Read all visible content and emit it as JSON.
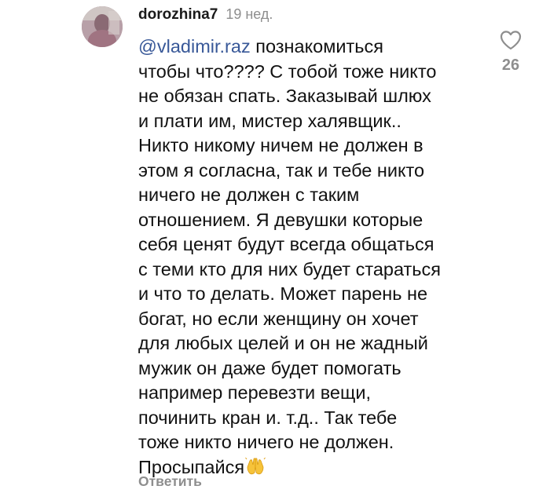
{
  "comment": {
    "username": "dorozhina7",
    "timestamp": "19 нед.",
    "mention": "vladimir.raz",
    "mention_prefix": "@",
    "lines": [
      " познакомиться",
      "чтобы что???? С тобой тоже никто",
      "не обязан спать. Заказывай шлюх",
      "и плати им, мистер халявщик..",
      "Никто никому ничем не должен в",
      "этом я согласна, так и тебе никто",
      "ничего не должен с таким",
      "отношением. Я девушки которые",
      "себя ценят будут всегда общаться",
      "с теми кто для них будет стараться",
      "и что то делать. Может парень не",
      "богат, но если женщину он хочет",
      "для любых целей и он не жадный",
      "мужик он даже будет помогать",
      "например перевезти вещи,",
      "починить кран и. т.д.. Так тебе",
      "тоже никто ничего не должен.",
      "Просыпайся"
    ],
    "emoji": "raising-hands-emoji",
    "reply_label": "Ответить",
    "like_icon": "heart-outline-icon",
    "like_count": "26",
    "avatar": "user-avatar"
  },
  "colors": {
    "text": "#111111",
    "muted": "#8e8e8e",
    "mention": "#385898",
    "background": "#ffffff"
  }
}
